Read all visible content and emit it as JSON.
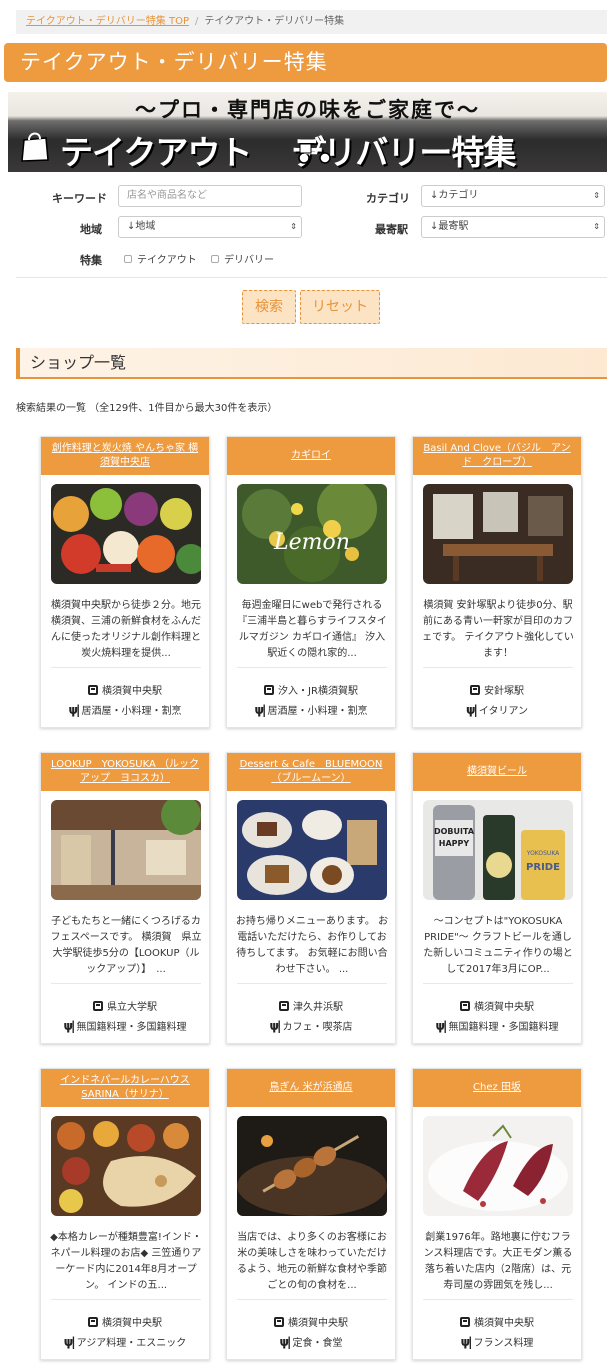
{
  "breadcrumb": {
    "home": "テイクアウト・デリバリー特集 TOP",
    "separator": "/",
    "current": "テイクアウト・デリバリー特集"
  },
  "page_title": "テイクアウト・デリバリー特集",
  "banner": {
    "subtitle": "〜プロ・専門店の味をご家庭で〜",
    "title_left": "テイクアウト",
    "title_right": "デリバリー特集"
  },
  "search": {
    "keyword_label": "キーワード",
    "keyword_placeholder": "店名や商品名など",
    "category_label": "カテゴリ",
    "category_value": "↓カテゴリ",
    "area_label": "地域",
    "area_value": "↓地域",
    "station_label": "最寄駅",
    "station_value": "↓最寄駅",
    "feature_label": "特集",
    "feature_takeout": "テイクアウト",
    "feature_delivery": "デリバリー",
    "search_button": "検索",
    "reset_button": "リセット"
  },
  "shops_heading": "ショップ一覧",
  "result_text": "検索結果の一覧 （全129件、1件目から最大30件を表示）",
  "shops": [
    {
      "name": "創作料理と炭火焼 やんちゃ家 横須賀中央店",
      "desc": "横須賀中央駅から徒歩２分。地元横須賀、三浦の新鮮食材をふんだんに使ったオリジナル創作料理と炭火焼料理を提供...",
      "station": "横須賀中央駅",
      "genre": "居酒屋・小料理・割烹",
      "image": "vegetables"
    },
    {
      "name": "カギロイ",
      "desc": "毎週金曜日にwebで発行される『三浦半島と暮らすライフスタイルマガジン カギロイ通信』 汐入駅近くの隠れ家的...",
      "station": "汐入・JR横須賀駅",
      "genre": "居酒屋・小料理・割烹",
      "image": "lemon-tree",
      "image_text": "Lemon"
    },
    {
      "name": "Basil And Clove（バジル　アンド　クローブ）",
      "desc": "横須賀 安針塚駅より徒歩0分、駅前にある青い一軒家が目印のカフェです。 テイクアウト強化しています！",
      "station": "安針塚駅",
      "genre": "イタリアン",
      "image": "cafe-interior"
    },
    {
      "name": "LOOKUP　YOKOSUKA （ルックアップ　ヨコスカ）",
      "desc": "子どもたちと一緒にくつろげるカフェスペースです。 横須賀　県立大学駅徒歩5分の【LOOKUP（ルックアップ）】　...",
      "station": "県立大学駅",
      "genre": "無国籍料理・多国籍料理",
      "image": "kids-cafe"
    },
    {
      "name": "Dessert & Cafe　BLUEMOON（ブルームーン）",
      "desc": "お持ち帰りメニューあります。 お電話いただけたら、お作りしてお待ちしてます。 お気軽にお問い合わせ下さい。 ...",
      "station": "津久井浜駅",
      "genre": "カフェ・喫茶店",
      "image": "desserts"
    },
    {
      "name": "横須賀ビール",
      "desc": "～コンセプトは\"YOKOSUKA PRIDE\"～ クラフトビールを通した新しいコミュニティ作りの場として2017年3月にOP...",
      "station": "横須賀中央駅",
      "genre": "無国籍料理・多国籍料理",
      "image": "beer",
      "image_text_1": "DOBUITA",
      "image_text_2": "HAPPY",
      "image_text_3": "YOKOSUKA",
      "image_text_4": "PRIDE"
    },
    {
      "name": "インドネパールカレーハウス SARINA（サリナ）",
      "desc": "◆本格カレーが種類豊富!インド・ネパール料理のお店◆ 三笠通りアーケード内に2014年8月オープン。 インドの五...",
      "station": "横須賀中央駅",
      "genre": "アジア料理・エスニック",
      "image": "curry"
    },
    {
      "name": "鳥ぎん 米が浜通店",
      "desc": "当店では、より多くのお客様にお米の美味しさを味わっていただけるよう、地元の新鮮な食材や季節ごとの旬の食材を...",
      "station": "横須賀中央駅",
      "genre": "定食・食堂",
      "image": "yakitori"
    },
    {
      "name": "Chez 田坂",
      "desc": "創業1976年。路地裏に佇むフランス料理店です。大正モダン薫る落ち着いた店内（2階席）は、元寿司屋の雰囲気を残し...",
      "station": "横須賀中央駅",
      "genre": "フランス料理",
      "image": "french"
    }
  ]
}
